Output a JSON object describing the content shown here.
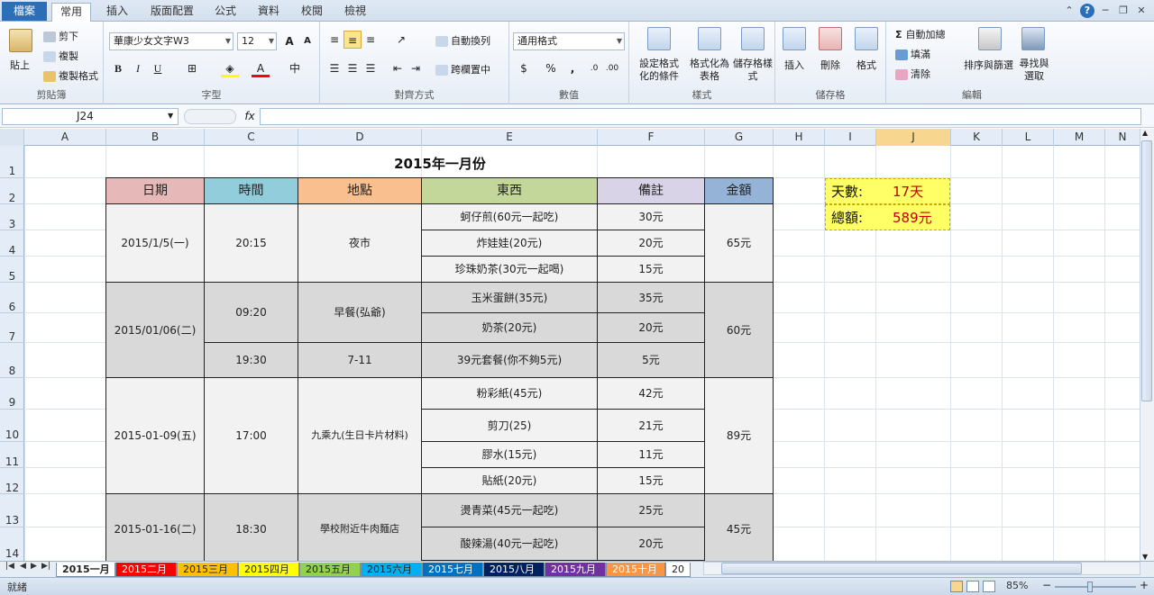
{
  "ribbon_tabs": [
    "檔案",
    "常用",
    "插入",
    "版面配置",
    "公式",
    "資料",
    "校閱",
    "檢視"
  ],
  "groups": {
    "clipboard": {
      "label": "剪貼簿",
      "paste": "貼上",
      "cut": "剪下",
      "copy": "複製",
      "format_painter": "複製格式"
    },
    "font": {
      "label": "字型",
      "font_name": "華康少女文字W3",
      "font_size": "12",
      "bold": "B",
      "italic": "I",
      "underline": "U"
    },
    "alignment": {
      "label": "對齊方式",
      "wrap": "自動換列",
      "merge": "跨欄置中"
    },
    "number": {
      "label": "數值",
      "format": "通用格式",
      "currency": "$",
      "percent": "%",
      "comma": ","
    },
    "styles": {
      "label": "樣式",
      "conditional": "設定格式化的條件",
      "table": "格式化為表格",
      "cell_styles": "儲存格樣式"
    },
    "cells": {
      "label": "儲存格",
      "insert": "插入",
      "delete": "刪除",
      "format": "格式"
    },
    "editing": {
      "label": "編輯",
      "autosum": "自動加總",
      "fill": "填滿",
      "clear": "清除",
      "sort": "排序與篩選",
      "find": "尋找與選取"
    }
  },
  "formula_bar": {
    "name_box": "J24",
    "fx": "fx",
    "value": ""
  },
  "columns": [
    "A",
    "B",
    "C",
    "D",
    "E",
    "F",
    "G",
    "H",
    "I",
    "J",
    "K",
    "L",
    "M",
    "N"
  ],
  "rows": [
    "1",
    "2",
    "3",
    "4",
    "5",
    "6",
    "7",
    "8",
    "9",
    "10",
    "11",
    "12",
    "13",
    "14"
  ],
  "sheet": {
    "title": "2015年一月份",
    "headers": [
      "日期",
      "時間",
      "地點",
      "東西",
      "備註",
      "金額"
    ],
    "header_colors": [
      "#e6b8b7",
      "#92cddc",
      "#fabf8f",
      "#c4d79b",
      "#d9d3e8",
      "#95b3d7"
    ],
    "entries": [
      {
        "date": "2015/1/5(一)",
        "time": "20:15",
        "place": "夜市",
        "items": [
          "蚵仔煎(60元一起吃)",
          "炸娃娃(20元)",
          "珍珠奶茶(30元一起喝)"
        ],
        "notes": [
          "30元",
          "20元",
          "15元"
        ],
        "amount": "65元"
      },
      {
        "date": "2015/01/06(二)",
        "times": [
          "09:20",
          "19:30"
        ],
        "places": [
          "早餐(弘爺)",
          "7-11"
        ],
        "items": [
          "玉米蛋餅(35元)",
          "奶茶(20元)",
          "39元套餐(你不夠5元)"
        ],
        "notes": [
          "35元",
          "20元",
          "5元"
        ],
        "amount": "60元"
      },
      {
        "date": "2015-01-09(五)",
        "time": "17:00",
        "place": "九乘九(生日卡片材料)",
        "items": [
          "粉彩紙(45元)",
          "剪刀(25)",
          "膠水(15元)",
          "貼紙(20元)"
        ],
        "notes": [
          "42元",
          "21元",
          "11元",
          "15元"
        ],
        "amount": "89元"
      },
      {
        "date": "2015-01-16(二)",
        "time": "18:30",
        "place": "學校附近牛肉麵店",
        "items": [
          "燙青菜(45元一起吃)",
          "酸辣湯(40元一起吃)"
        ],
        "notes": [
          "25元",
          "20元"
        ],
        "amount": "45元"
      }
    ],
    "summary": {
      "days_label": "天數:",
      "days_value": "17天",
      "total_label": "總額:",
      "total_value": "589元"
    }
  },
  "sheet_tabs": [
    {
      "name": "2015一月",
      "color": "#ffffff"
    },
    {
      "name": "2015二月",
      "color": "#ff0000"
    },
    {
      "name": "2015三月",
      "color": "#ffc000"
    },
    {
      "name": "2015四月",
      "color": "#ffff00"
    },
    {
      "name": "2015五月",
      "color": "#92d050"
    },
    {
      "name": "2015六月",
      "color": "#00b0f0"
    },
    {
      "name": "2015七月",
      "color": "#0070c0"
    },
    {
      "name": "2015八月",
      "color": "#002060"
    },
    {
      "name": "2015九月",
      "color": "#7030a0"
    },
    {
      "name": "2015十月",
      "color": "#f79646"
    },
    {
      "name": "20",
      "color": "#ffffff"
    }
  ],
  "status": {
    "ready": "就緒",
    "zoom": "85%"
  }
}
